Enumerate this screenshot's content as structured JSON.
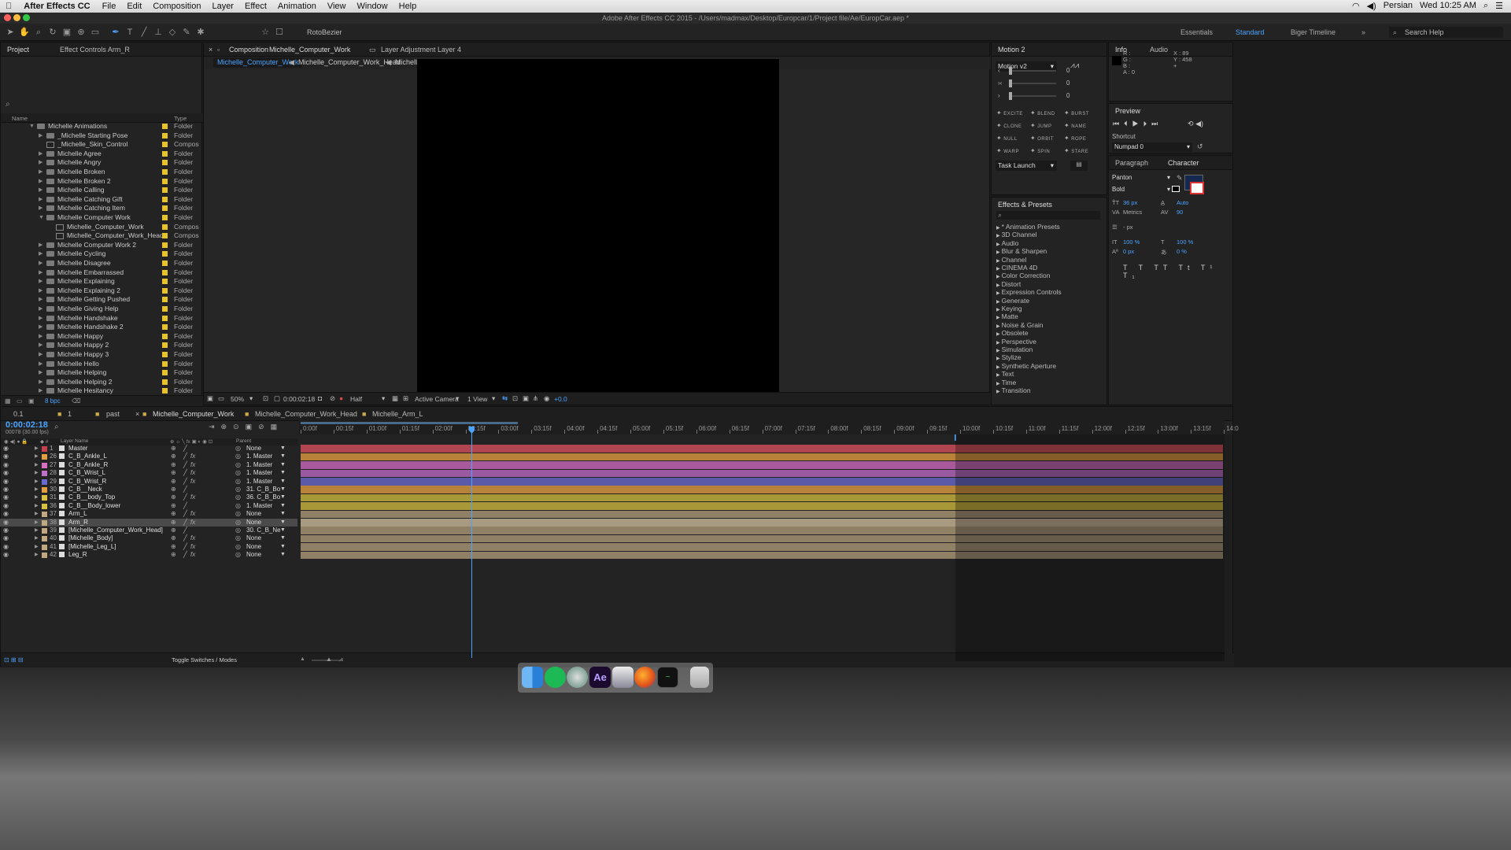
{
  "menubar": {
    "app": "After Effects CC",
    "items": [
      "File",
      "Edit",
      "Composition",
      "Layer",
      "Effect",
      "Animation",
      "View",
      "Window",
      "Help"
    ],
    "language": "Persian",
    "clock": "Wed 10:25 AM"
  },
  "window_title": "Adobe After Effects CC 2015 - /Users/madmax/Desktop/Europcar/1/Project file/Ae/EuropCar.aep *",
  "toolbar": {
    "rotobezier": "RotoBezier",
    "workspaces": [
      "Essentials",
      "Standard",
      "Biger Timeline"
    ],
    "active_workspace": "Standard",
    "search_help": "Search Help"
  },
  "project": {
    "tab": "Project",
    "effect_controls_tab": "Effect Controls Arm_R",
    "col_name": "Name",
    "col_type": "Type",
    "bpc": "8 bpc",
    "items": [
      {
        "name": "Michelle Animations",
        "type": "Folder",
        "kind": "folder",
        "open": true,
        "indent": 0
      },
      {
        "name": "_Michelle Starting Pose",
        "type": "Folder",
        "kind": "folder",
        "indent": 1
      },
      {
        "name": "_Michelle_Skin_Control",
        "type": "Compos",
        "kind": "comp",
        "indent": 1
      },
      {
        "name": "Michelle Agree",
        "type": "Folder",
        "kind": "folder",
        "indent": 1
      },
      {
        "name": "Michelle Angry",
        "type": "Folder",
        "kind": "folder",
        "indent": 1
      },
      {
        "name": "Michelle Broken",
        "type": "Folder",
        "kind": "folder",
        "indent": 1
      },
      {
        "name": "Michelle Broken 2",
        "type": "Folder",
        "kind": "folder",
        "indent": 1
      },
      {
        "name": "Michelle Calling",
        "type": "Folder",
        "kind": "folder",
        "indent": 1
      },
      {
        "name": "Michelle Catching Gift",
        "type": "Folder",
        "kind": "folder",
        "indent": 1
      },
      {
        "name": "Michelle Catching Item",
        "type": "Folder",
        "kind": "folder",
        "indent": 1
      },
      {
        "name": "Michelle Computer Work",
        "type": "Folder",
        "kind": "folder",
        "open": true,
        "indent": 1
      },
      {
        "name": "Michelle_Computer_Work",
        "type": "Compos",
        "kind": "comp",
        "indent": 2
      },
      {
        "name": "Michelle_Computer_Work_Head",
        "type": "Compos",
        "kind": "comp",
        "indent": 2
      },
      {
        "name": "Michelle Computer Work 2",
        "type": "Folder",
        "kind": "folder",
        "indent": 1
      },
      {
        "name": "Michelle Cycling",
        "type": "Folder",
        "kind": "folder",
        "indent": 1
      },
      {
        "name": "Michelle Disagree",
        "type": "Folder",
        "kind": "folder",
        "indent": 1
      },
      {
        "name": "Michelle Embarrassed",
        "type": "Folder",
        "kind": "folder",
        "indent": 1
      },
      {
        "name": "Michelle Explaining",
        "type": "Folder",
        "kind": "folder",
        "indent": 1
      },
      {
        "name": "Michelle Explaining 2",
        "type": "Folder",
        "kind": "folder",
        "indent": 1
      },
      {
        "name": "Michelle Getting Pushed",
        "type": "Folder",
        "kind": "folder",
        "indent": 1
      },
      {
        "name": "Michelle Giving Help",
        "type": "Folder",
        "kind": "folder",
        "indent": 1
      },
      {
        "name": "Michelle Handshake",
        "type": "Folder",
        "kind": "folder",
        "indent": 1
      },
      {
        "name": "Michelle Handshake 2",
        "type": "Folder",
        "kind": "folder",
        "indent": 1
      },
      {
        "name": "Michelle Happy",
        "type": "Folder",
        "kind": "folder",
        "indent": 1
      },
      {
        "name": "Michelle Happy 2",
        "type": "Folder",
        "kind": "folder",
        "indent": 1
      },
      {
        "name": "Michelle Happy 3",
        "type": "Folder",
        "kind": "folder",
        "indent": 1
      },
      {
        "name": "Michelle Hello",
        "type": "Folder",
        "kind": "folder",
        "indent": 1
      },
      {
        "name": "Michelle Helping",
        "type": "Folder",
        "kind": "folder",
        "indent": 1
      },
      {
        "name": "Michelle Helping 2",
        "type": "Folder",
        "kind": "folder",
        "indent": 1
      },
      {
        "name": "Michelle Hesitancy",
        "type": "Folder",
        "kind": "folder",
        "indent": 1
      }
    ]
  },
  "composition": {
    "tab_prefix": "Composition",
    "tab_name": "Michelle_Computer_Work",
    "second_tab": "Layer Adjustment Layer 4",
    "breadcrumbs": [
      "Michelle_Computer_Work",
      "Michelle_Computer_Work_Head",
      "Michelle Hat"
    ],
    "footer": {
      "zoom": "50%",
      "timecode": "0:00:02:18",
      "resolution": "Half",
      "camera": "Active Camera",
      "views": "1 View",
      "exposure": "+0.0"
    }
  },
  "motion": {
    "tab": "Motion 2",
    "preset": "Motion v2",
    "values": [
      "0",
      "0",
      "0"
    ],
    "buttons": [
      "EXCITE",
      "BLEND",
      "BURST",
      "CLONE",
      "JUMP",
      "NAME",
      "NULL",
      "ORBIT",
      "ROPE",
      "WARP",
      "SPIN",
      "STARE"
    ],
    "task": "Task Launch"
  },
  "info": {
    "tab": "Info",
    "audio_tab": "Audio",
    "r": "R :",
    "g": "G :",
    "b": "B :",
    "a": "A : 0",
    "x": "X : 89",
    "y": "Y : 458"
  },
  "preview": {
    "tab": "Preview",
    "shortcut_label": "Shortcut",
    "shortcut": "Numpad 0"
  },
  "character": {
    "paragraph_tab": "Paragraph",
    "tab": "Character",
    "font": "Panton",
    "style": "Bold",
    "size": "36 px",
    "leading": "Auto",
    "kerning": "Metrics",
    "tracking": "90",
    "stroke": "- px",
    "vscale": "100 %",
    "hscale": "100 %",
    "baseline": "0 px",
    "tsume": "0 %"
  },
  "effects": {
    "tab": "Effects & Presets",
    "items": [
      "* Animation Presets",
      "3D Channel",
      "Audio",
      "Blur & Sharpen",
      "Channel",
      "CINEMA 4D",
      "Color Correction",
      "Distort",
      "Expression Controls",
      "Generate",
      "Keying",
      "Matte",
      "Noise & Grain",
      "Obsolete",
      "Perspective",
      "Simulation",
      "Stylize",
      "Synthetic Aperture",
      "Text",
      "Time",
      "Transition"
    ]
  },
  "timeline": {
    "tabs": [
      "0.1",
      "1",
      "past",
      "Michelle_Computer_Work",
      "Michelle_Computer_Work_Head",
      "Michelle_Arm_L"
    ],
    "active_tab": "Michelle_Computer_Work",
    "timecode": "0:00:02:18",
    "frames": "00078 (30.00 fps)",
    "col_layer": "Layer Name",
    "col_parent": "Parent",
    "toggle": "Toggle Switches / Modes",
    "ticks": [
      "0:00f",
      "00:15f",
      "01:00f",
      "01:15f",
      "02:00f",
      "02:15f",
      "03:00f",
      "03:15f",
      "04:00f",
      "04:15f",
      "05:00f",
      "05:15f",
      "06:00f",
      "06:15f",
      "07:00f",
      "07:15f",
      "08:00f",
      "08:15f",
      "09:00f",
      "09:15f",
      "10:00f",
      "10:15f",
      "11:00f",
      "11:15f",
      "12:00f",
      "12:15f",
      "13:00f",
      "13:15f",
      "14:0"
    ],
    "current_time_s": 2.6,
    "work_area_end_s": 10.0,
    "layers": [
      {
        "num": "1",
        "name": "Master",
        "label": "#c7414f",
        "bar": "#b24650",
        "parent": "None",
        "fx": false
      },
      {
        "num": "26",
        "name": "C_B_Ankle_L",
        "label": "#e0a040",
        "bar": "#b8823a",
        "parent": "1. Master",
        "fx": true
      },
      {
        "num": "27",
        "name": "C_B_Ankle_R",
        "label": "#d86fc0",
        "bar": "#a85a9a",
        "parent": "1. Master",
        "fx": true
      },
      {
        "num": "28",
        "name": "C_B_Wrist_L",
        "label": "#c070c8",
        "bar": "#9a5aa2",
        "parent": "1. Master",
        "fx": true
      },
      {
        "num": "29",
        "name": "C_B_Wrist_R",
        "label": "#6a6ad0",
        "bar": "#5a5aa8",
        "parent": "1. Master",
        "fx": true
      },
      {
        "num": "30",
        "name": "C_B__Neck",
        "label": "#e0a040",
        "bar": "#b8823a",
        "parent": "31. C_B_Bo",
        "fx": false
      },
      {
        "num": "31",
        "name": "C_B__body_Top",
        "label": "#d8c040",
        "bar": "#a89838",
        "parent": "36. C_B_Bo",
        "fx": true
      },
      {
        "num": "36",
        "name": "C_B__Body_lower",
        "label": "#d8c040",
        "bar": "#a89838",
        "parent": "1. Master",
        "fx": false
      },
      {
        "num": "37",
        "name": "Arm_L",
        "label": "#c0a880",
        "bar": "#8f8066",
        "parent": "None",
        "fx": true
      },
      {
        "num": "38",
        "name": "Arm_R",
        "label": "#c0a880",
        "bar": "#a89a80",
        "parent": "None",
        "fx": true,
        "selected": true
      },
      {
        "num": "39",
        "name": "[Michelle_Computer_Work_Head]",
        "label": "#c0a880",
        "bar": "#8f8066",
        "parent": "30. C_B_Ne",
        "fx": false
      },
      {
        "num": "40",
        "name": "[Michelle_Body]",
        "label": "#c0a880",
        "bar": "#8f8066",
        "parent": "None",
        "fx": true
      },
      {
        "num": "41",
        "name": "[Michelle_Leg_L]",
        "label": "#c0a880",
        "bar": "#8f8066",
        "parent": "None",
        "fx": true
      },
      {
        "num": "42",
        "name": "Leg_R",
        "label": "#c0a880",
        "bar": "#8f8066",
        "parent": "None",
        "fx": true
      }
    ]
  }
}
